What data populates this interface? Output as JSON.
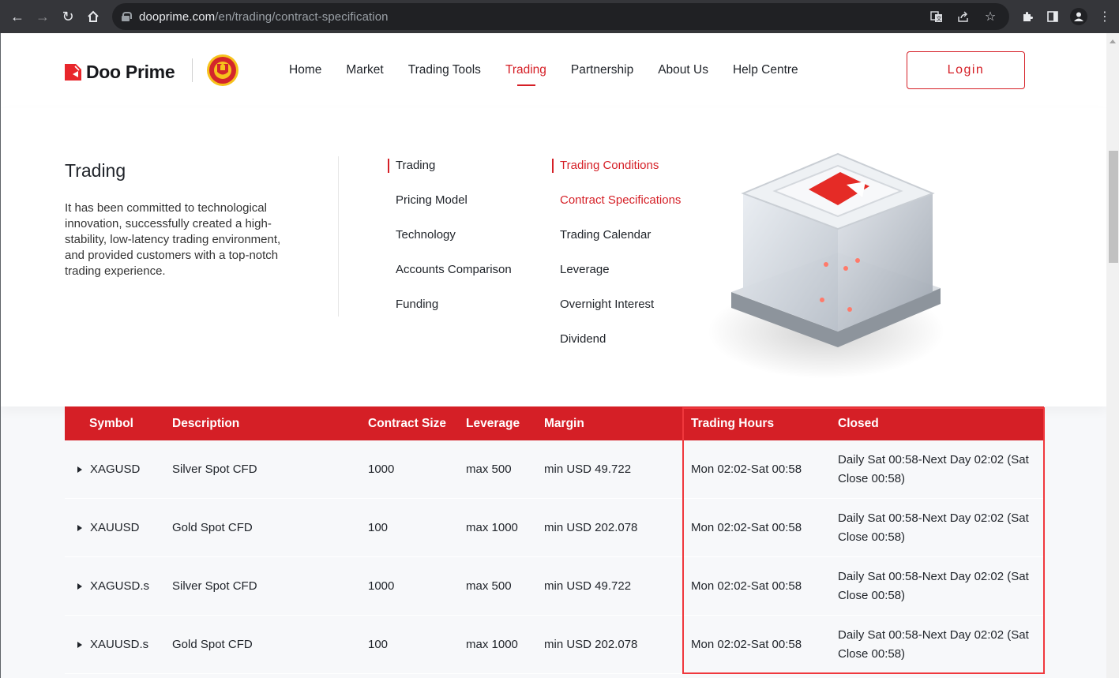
{
  "browser": {
    "url_host": "dooprime.com",
    "url_path": "/en/trading/contract-specification",
    "icons": [
      "back-icon",
      "forward-icon",
      "reload-icon",
      "home-icon",
      "lock-icon",
      "translate-icon",
      "share-icon",
      "bookmark-star-icon",
      "extensions-icon",
      "side-panel-icon",
      "profile-icon",
      "menu-kebab-icon"
    ]
  },
  "header": {
    "brand": "Doo Prime",
    "partner": "Manchester United crest",
    "nav": [
      {
        "label": "Home",
        "active": false
      },
      {
        "label": "Market",
        "active": false
      },
      {
        "label": "Trading Tools",
        "active": false
      },
      {
        "label": "Trading",
        "active": true
      },
      {
        "label": "Partnership",
        "active": false
      },
      {
        "label": "About Us",
        "active": false
      },
      {
        "label": "Help Centre",
        "active": false
      }
    ],
    "login_label": "Login"
  },
  "mega_menu": {
    "title": "Trading",
    "description": "It has been committed to technological innovation, successfully created a high-stability, low-latency trading environment, and provided customers with a top-notch trading experience.",
    "col1": [
      "Trading",
      "Pricing Model",
      "Technology",
      "Accounts Comparison",
      "Funding"
    ],
    "col2": [
      "Trading Conditions",
      "Contract Specifications",
      "Trading Calendar",
      "Leverage",
      "Overnight Interest",
      "Dividend"
    ],
    "col2_active": "Contract Specifications"
  },
  "table": {
    "headers": [
      "Symbol",
      "Description",
      "Contract Size",
      "Leverage",
      "Margin",
      "Trading Hours",
      "Closed"
    ],
    "rows": [
      {
        "symbol": "XAGUSD",
        "description": "Silver Spot CFD",
        "contract_size": "1000",
        "leverage": "max 500",
        "margin": "min USD 49.722",
        "trading_hours": "Mon 02:02-Sat 00:58",
        "closed": "Daily Sat 00:58-Next Day 02:02 (Sat Close 00:58)"
      },
      {
        "symbol": "XAUUSD",
        "description": "Gold Spot CFD",
        "contract_size": "100",
        "leverage": "max 1000",
        "margin": "min USD 202.078",
        "trading_hours": "Mon 02:02-Sat 00:58",
        "closed": "Daily Sat 00:58-Next Day 02:02 (Sat Close 00:58)"
      },
      {
        "symbol": "XAGUSD.s",
        "description": "Silver Spot CFD",
        "contract_size": "1000",
        "leverage": "max 500",
        "margin": "min USD 49.722",
        "trading_hours": "Mon 02:02-Sat 00:58",
        "closed": "Daily Sat 00:58-Next Day 02:02 (Sat Close 00:58)"
      },
      {
        "symbol": "XAUUSD.s",
        "description": "Gold Spot CFD",
        "contract_size": "100",
        "leverage": "max 1000",
        "margin": "min USD 202.078",
        "trading_hours": "Mon 02:02-Sat 00:58",
        "closed": "Daily Sat 00:58-Next Day 02:02 (Sat Close 00:58)"
      }
    ]
  },
  "colors": {
    "brand_red": "#d51f26",
    "highlight": "#f0383d"
  }
}
